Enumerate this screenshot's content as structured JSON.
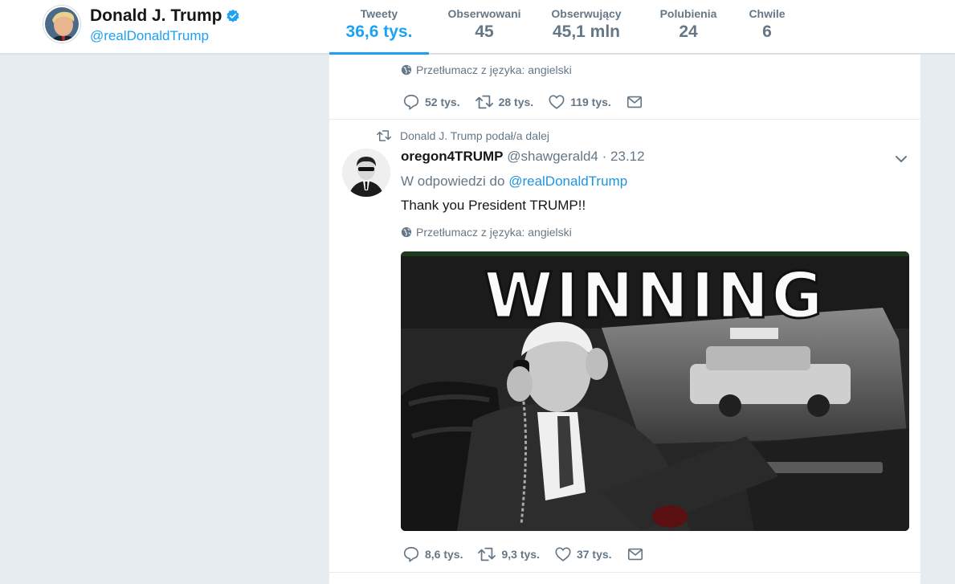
{
  "profile": {
    "name": "Donald J. Trump",
    "handle": "@realDonaldTrump"
  },
  "stats": [
    {
      "label": "Tweety",
      "value": "36,6 tys.",
      "active": true
    },
    {
      "label": "Obserwowani",
      "value": "45"
    },
    {
      "label": "Obserwujący",
      "value": "45,1 mln"
    },
    {
      "label": "Polubienia",
      "value": "24"
    },
    {
      "label": "Chwile",
      "value": "6"
    }
  ],
  "tweet_prev": {
    "translate": "Przetłumacz z języka: angielski",
    "replies": "52 tys.",
    "retweets": "28 tys.",
    "likes": "119 tys."
  },
  "tweet": {
    "retweet_context": "Donald J. Trump podał/a dalej",
    "author_name": "oregon4TRUMP",
    "author_handle": "@shawgerald4",
    "separator": "·",
    "date": "23.12",
    "reply_prefix": "W odpowiedzi do",
    "reply_mention": "@realDonaldTrump",
    "text": "Thank you President TRUMP!!",
    "translate": "Przetłumacz z języka: angielski",
    "image_caption": "WINNING",
    "replies": "8,6 tys.",
    "retweets": "9,3 tys.",
    "likes": "37 tys."
  },
  "colors": {
    "accent": "#1da1f2",
    "muted": "#657786",
    "background": "#e6ecf0"
  },
  "icons": [
    "verified-icon",
    "globe-icon",
    "reply-icon",
    "retweet-icon",
    "like-icon",
    "message-icon",
    "chevron-down-icon"
  ]
}
